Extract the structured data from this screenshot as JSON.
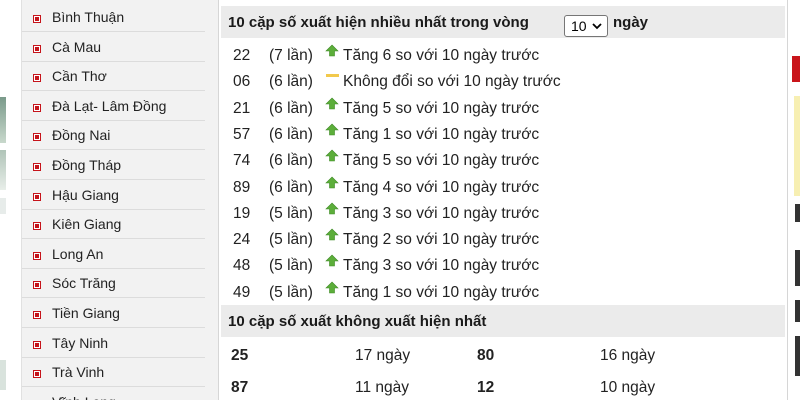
{
  "sidebar": {
    "items": [
      {
        "label": "Bình Thuận"
      },
      {
        "label": "Cà Mau"
      },
      {
        "label": "Cần Thơ"
      },
      {
        "label": "Đà Lạt- Lâm Đồng"
      },
      {
        "label": "Đồng Nai"
      },
      {
        "label": "Đồng Tháp"
      },
      {
        "label": "Hậu Giang"
      },
      {
        "label": "Kiên Giang"
      },
      {
        "label": "Long An"
      },
      {
        "label": "Sóc Trăng"
      },
      {
        "label": "Tiền Giang"
      },
      {
        "label": "Tây Ninh"
      },
      {
        "label": "Trà Vinh"
      },
      {
        "label": "Vĩnh Long"
      }
    ]
  },
  "frequent": {
    "title": "10 cặp số xuất hiện nhiều nhất trong vòng",
    "period_value": "10",
    "period_suffix": "ngày",
    "rows": [
      {
        "number": "22",
        "count": "(7 lần)",
        "trend": "up",
        "desc": "Tăng 6 so với 10 ngày trước"
      },
      {
        "number": "06",
        "count": "(6 lần)",
        "trend": "same",
        "desc": "Không đổi so với 10 ngày trước"
      },
      {
        "number": "21",
        "count": "(6 lần)",
        "trend": "up",
        "desc": "Tăng 5 so với 10 ngày trước"
      },
      {
        "number": "57",
        "count": "(6 lần)",
        "trend": "up",
        "desc": "Tăng 1 so với 10 ngày trước"
      },
      {
        "number": "74",
        "count": "(6 lần)",
        "trend": "up",
        "desc": "Tăng 5 so với 10 ngày trước"
      },
      {
        "number": "89",
        "count": "(6 lần)",
        "trend": "up",
        "desc": "Tăng 4 so với 10 ngày trước"
      },
      {
        "number": "19",
        "count": "(5 lần)",
        "trend": "up",
        "desc": "Tăng 3 so với 10 ngày trước"
      },
      {
        "number": "24",
        "count": "(5 lần)",
        "trend": "up",
        "desc": "Tăng 2 so với 10 ngày trước"
      },
      {
        "number": "48",
        "count": "(5 lần)",
        "trend": "up",
        "desc": "Tăng 3 so với 10 ngày trước"
      },
      {
        "number": "49",
        "count": "(5 lần)",
        "trend": "up",
        "desc": "Tăng 1 so với 10 ngày trước"
      }
    ]
  },
  "cold": {
    "title": "10 cặp số xuất không xuất hiện nhất",
    "rows": [
      {
        "n1": "25",
        "d1": "17 ngày",
        "n2": "80",
        "d2": "16 ngày"
      },
      {
        "n1": "87",
        "d1": "11 ngày",
        "n2": "12",
        "d2": "10 ngày"
      }
    ]
  },
  "colors": {
    "accent_red": "#c6141b",
    "up_arrow_green": "#5cae3a",
    "same_bar_yellow": "#f2c94c",
    "header_bg": "#ebebeb",
    "sidebar_bg": "#f2f2f2"
  },
  "icons": {
    "sidebar_bullet": "square-bullet-icon",
    "trend_up": "arrow-up-icon",
    "trend_same": "dash-icon",
    "select": "chevron-down-icon"
  }
}
